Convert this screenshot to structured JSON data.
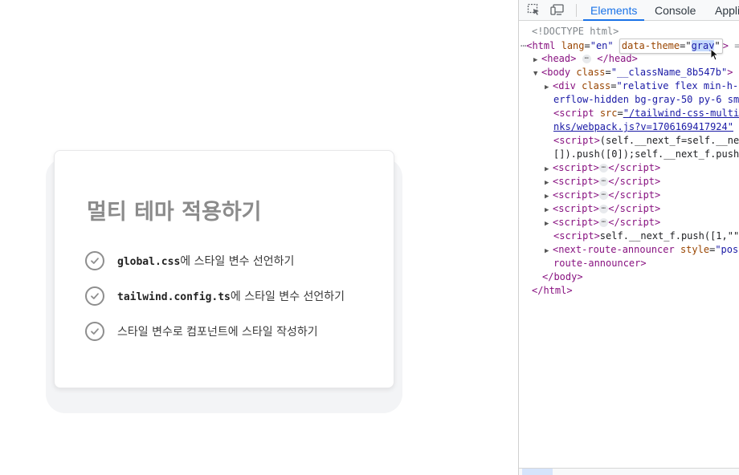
{
  "card": {
    "title": "멀티 테마 적용하기",
    "items": [
      {
        "code": "global.css",
        "text": "에 스타일 변수 선언하기"
      },
      {
        "code": "tailwind.config.ts",
        "text": "에 스타일 변수 선언하기"
      },
      {
        "code": "",
        "text": "스타일 변수로 컴포넌트에 스타일 작성하기"
      }
    ]
  },
  "devtools": {
    "tabs": {
      "elements": "Elements",
      "console": "Console",
      "application": "Appli"
    },
    "doctype": "<!DOCTYPE html>",
    "html_line": {
      "lang_attr": "lang",
      "lang_val": "\"en\"",
      "theme_attr": "data-theme",
      "theme_val": "gray"
    },
    "head": "head",
    "body_class": "\"__className_8b547b\"",
    "div_class": "\"relative flex min-h-",
    "div_class_2": "erflow-hidden bg-gray-50 py-6 sm",
    "script_src": "\"/tailwind-css-multi",
    "script_src_2": "nks/webpack.js?v=1706169417924\"",
    "inline_script_1": "(self.__next_f=self.__ne",
    "inline_script_2": "[]).push([0]);self.__next_f.push",
    "inline_script_3": "self.__next_f.push([1,\"\"",
    "announcer_style": "\"pos",
    "announcer_close": "route-announcer>"
  },
  "colors": {
    "accent": "#1a73e8",
    "tag": "#881280",
    "attr": "#994500",
    "value": "#1a1aa6"
  },
  "icons": [
    "check-circle-icon",
    "inspect-element-icon",
    "device-toggle-icon",
    "mouse-pointer-icon"
  ]
}
